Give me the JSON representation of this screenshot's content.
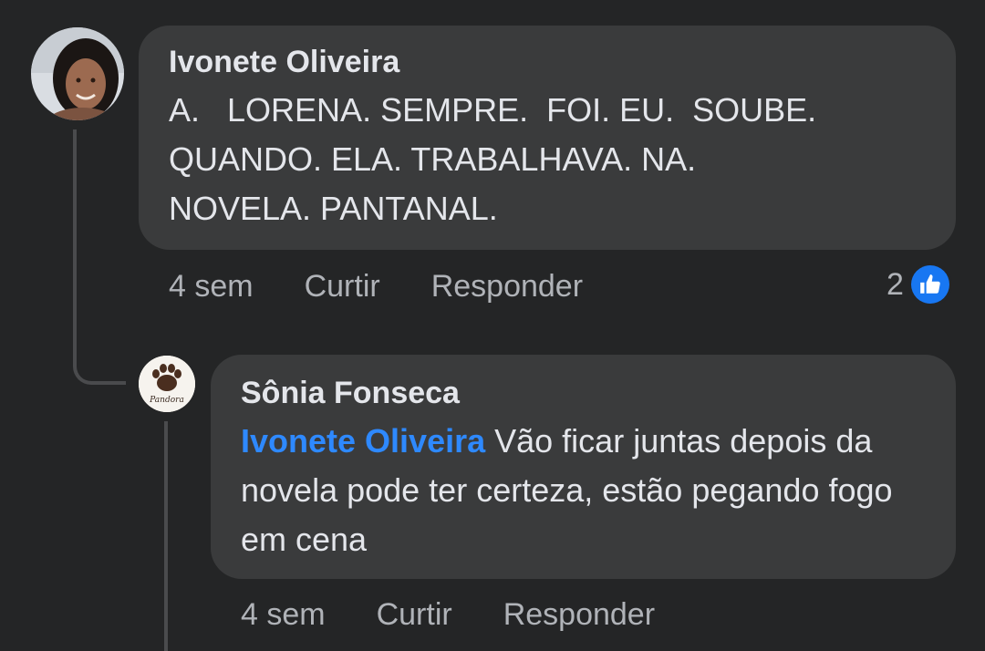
{
  "comments": [
    {
      "author": "Ivonete Oliveira",
      "text": "A.   LORENA. SEMPRE.  FOI. EU.  SOUBE.\nQUANDO. ELA. TRABALHAVA. NA.\nNOVELA. PANTANAL.",
      "time": "4 sem",
      "like_label": "Curtir",
      "reply_label": "Responder",
      "reaction_count": "2",
      "reaction_icon": "like-icon",
      "accent": "#1877f2"
    },
    {
      "author": "Sônia Fonseca",
      "mention": "Ivonete Oliveira",
      "text": " Vão ficar juntas depois da novela pode ter certeza, estão pegando fogo em cena",
      "time": "4 sem",
      "like_label": "Curtir",
      "reply_label": "Responder",
      "avatar_caption": "Pandora",
      "mention_color": "#2e89ff"
    }
  ]
}
